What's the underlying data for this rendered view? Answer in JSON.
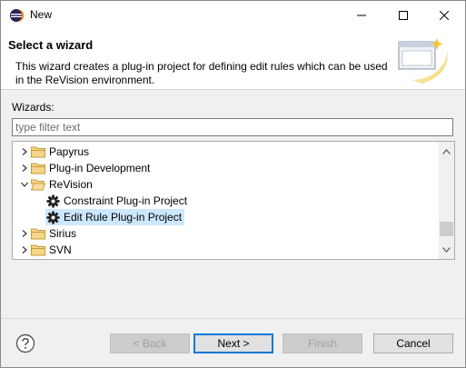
{
  "window": {
    "title": "New"
  },
  "banner": {
    "title": "Select a wizard",
    "description": "This wizard creates a plug-in project for defining edit rules which can be used in the ReVision environment."
  },
  "wizards": {
    "label": "Wizards:",
    "filter_placeholder": "type filter text",
    "items": [
      {
        "label": "Papyrus",
        "icon": "folder-icon",
        "expanded": false
      },
      {
        "label": "Plug-in Development",
        "icon": "folder-icon",
        "expanded": false
      },
      {
        "label": "ReVision",
        "icon": "folder-icon",
        "expanded": true
      },
      {
        "label": "Constraint Plug-in Project",
        "icon": "gear-icon"
      },
      {
        "label": "Edit Rule Plug-in Project",
        "icon": "gear-icon",
        "selected": true
      },
      {
        "label": "Sirius",
        "icon": "folder-icon",
        "expanded": false
      },
      {
        "label": "SVN",
        "icon": "folder-icon",
        "expanded": false
      }
    ]
  },
  "buttons": {
    "back": "< Back",
    "next": "Next >",
    "finish": "Finish",
    "cancel": "Cancel"
  },
  "colors": {
    "selection": "#cce8ff",
    "folder": "#dcb35c",
    "default_button_border": "#0078d7"
  }
}
